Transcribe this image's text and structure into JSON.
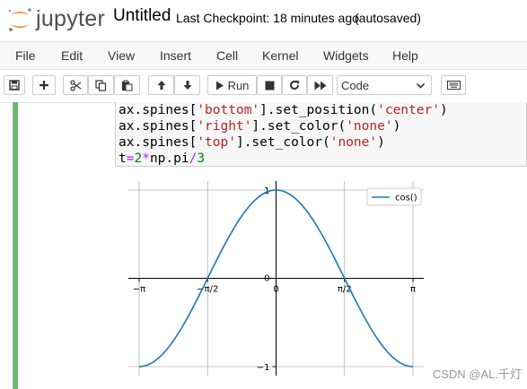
{
  "header": {
    "logo_text": "jupyter",
    "notebook_name": "Untitled",
    "checkpoint": "Last Checkpoint: 18 minutes ago",
    "autosave": "(autosaved)"
  },
  "menu": [
    "File",
    "Edit",
    "View",
    "Insert",
    "Cell",
    "Kernel",
    "Widgets",
    "Help"
  ],
  "toolbar": {
    "run_label": "Run",
    "cell_type": "Code",
    "icons": [
      "save-icon",
      "add-cell-icon",
      "cut-icon",
      "copy-icon",
      "paste-icon",
      "move-up-icon",
      "move-down-icon",
      "run-icon",
      "stop-icon",
      "restart-icon",
      "fast-forward-icon",
      "keyboard-icon"
    ]
  },
  "code_lines": [
    [
      {
        "t": "ax.spines[",
        "c": "plain"
      },
      {
        "t": "'bottom'",
        "c": "str"
      },
      {
        "t": "].set_position(",
        "c": "plain"
      },
      {
        "t": "'center'",
        "c": "str"
      },
      {
        "t": ")",
        "c": "plain"
      }
    ],
    [
      {
        "t": "ax.spines[",
        "c": "plain"
      },
      {
        "t": "'right'",
        "c": "str"
      },
      {
        "t": "].set_color(",
        "c": "plain"
      },
      {
        "t": "'none'",
        "c": "str"
      },
      {
        "t": ")",
        "c": "plain"
      }
    ],
    [
      {
        "t": "ax.spines[",
        "c": "plain"
      },
      {
        "t": "'top'",
        "c": "str"
      },
      {
        "t": "].set_color(",
        "c": "plain"
      },
      {
        "t": "'none'",
        "c": "str"
      },
      {
        "t": ")",
        "c": "plain"
      }
    ],
    [
      {
        "t": "t",
        "c": "plain"
      },
      {
        "t": "=",
        "c": "op"
      },
      {
        "t": "2",
        "c": "num"
      },
      {
        "t": "*",
        "c": "op"
      },
      {
        "t": "np.pi",
        "c": "plain"
      },
      {
        "t": "/",
        "c": "op"
      },
      {
        "t": "3",
        "c": "num"
      }
    ]
  ],
  "chart_data": {
    "type": "line",
    "series": [
      {
        "name": "cos()",
        "color": "#1f77b4",
        "function": "cos"
      }
    ],
    "xlim": [
      -3.14159,
      3.14159
    ],
    "ylim": [
      -1,
      1
    ],
    "xticks": [
      {
        "value": -3.14159,
        "label": "−π"
      },
      {
        "value": -1.5708,
        "label": "−π/2"
      },
      {
        "value": 0,
        "label": "0"
      },
      {
        "value": 1.5708,
        "label": "π/2"
      },
      {
        "value": 3.14159,
        "label": "π"
      }
    ],
    "yticks": [
      {
        "value": -1,
        "label": "−1"
      },
      {
        "value": 0,
        "label": "0"
      },
      {
        "value": 1,
        "label": "1"
      }
    ],
    "grid": true,
    "legend_position": "top-right",
    "spines": "centered"
  },
  "watermark": "CSDN @AL.千灯"
}
